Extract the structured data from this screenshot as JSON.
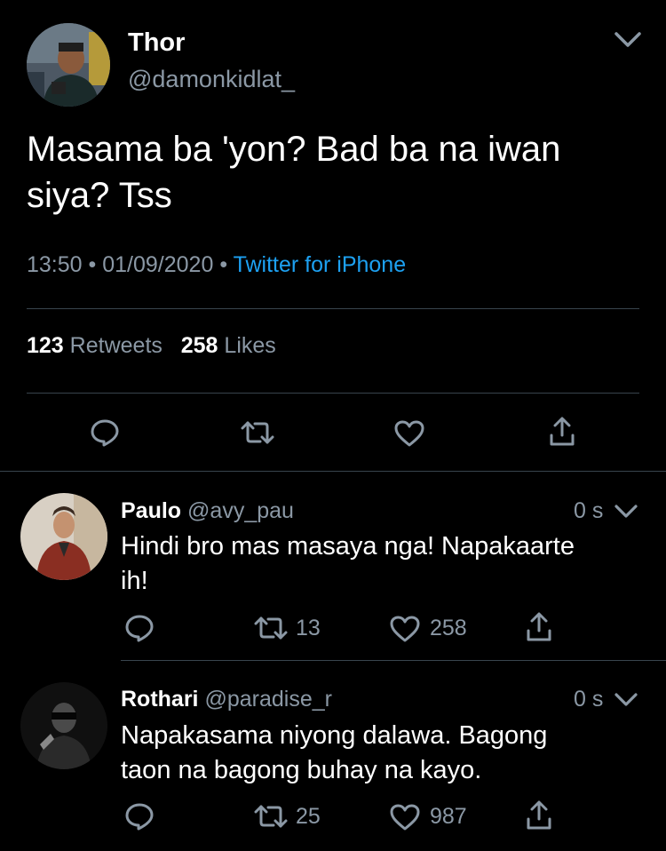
{
  "main_tweet": {
    "name": "Thor",
    "handle": "@damonkidlat_",
    "text_line1": "Masama ba 'yon? Bad ba na iwan",
    "text_line2": "siya? Tss",
    "time": "13:50",
    "sep1": "•",
    "date": "01/09/2020",
    "sep2": "•",
    "source": "Twitter for iPhone",
    "retweets_count": "123",
    "retweets_label": "Retweets",
    "likes_count": "258",
    "likes_label": "Likes"
  },
  "replies": [
    {
      "name": "Paulo",
      "handle": "@avy_pau",
      "time": "0 s",
      "text_line1": "Hindi bro mas masaya nga! Napakaarte",
      "text_line2": "ih!",
      "retweets": "13",
      "likes": "258"
    },
    {
      "name": "Rothari",
      "handle": "@paradise_r",
      "time": "0 s",
      "text_line1": "Napakasama niyong dalawa. Bagong",
      "text_line2": "taon na bagong buhay na kayo.",
      "retweets": "25",
      "likes": "987"
    }
  ],
  "colors": {
    "background": "#000000",
    "link": "#1da1f2",
    "secondary_text": "#8b98a5",
    "divider": "#38444d"
  }
}
